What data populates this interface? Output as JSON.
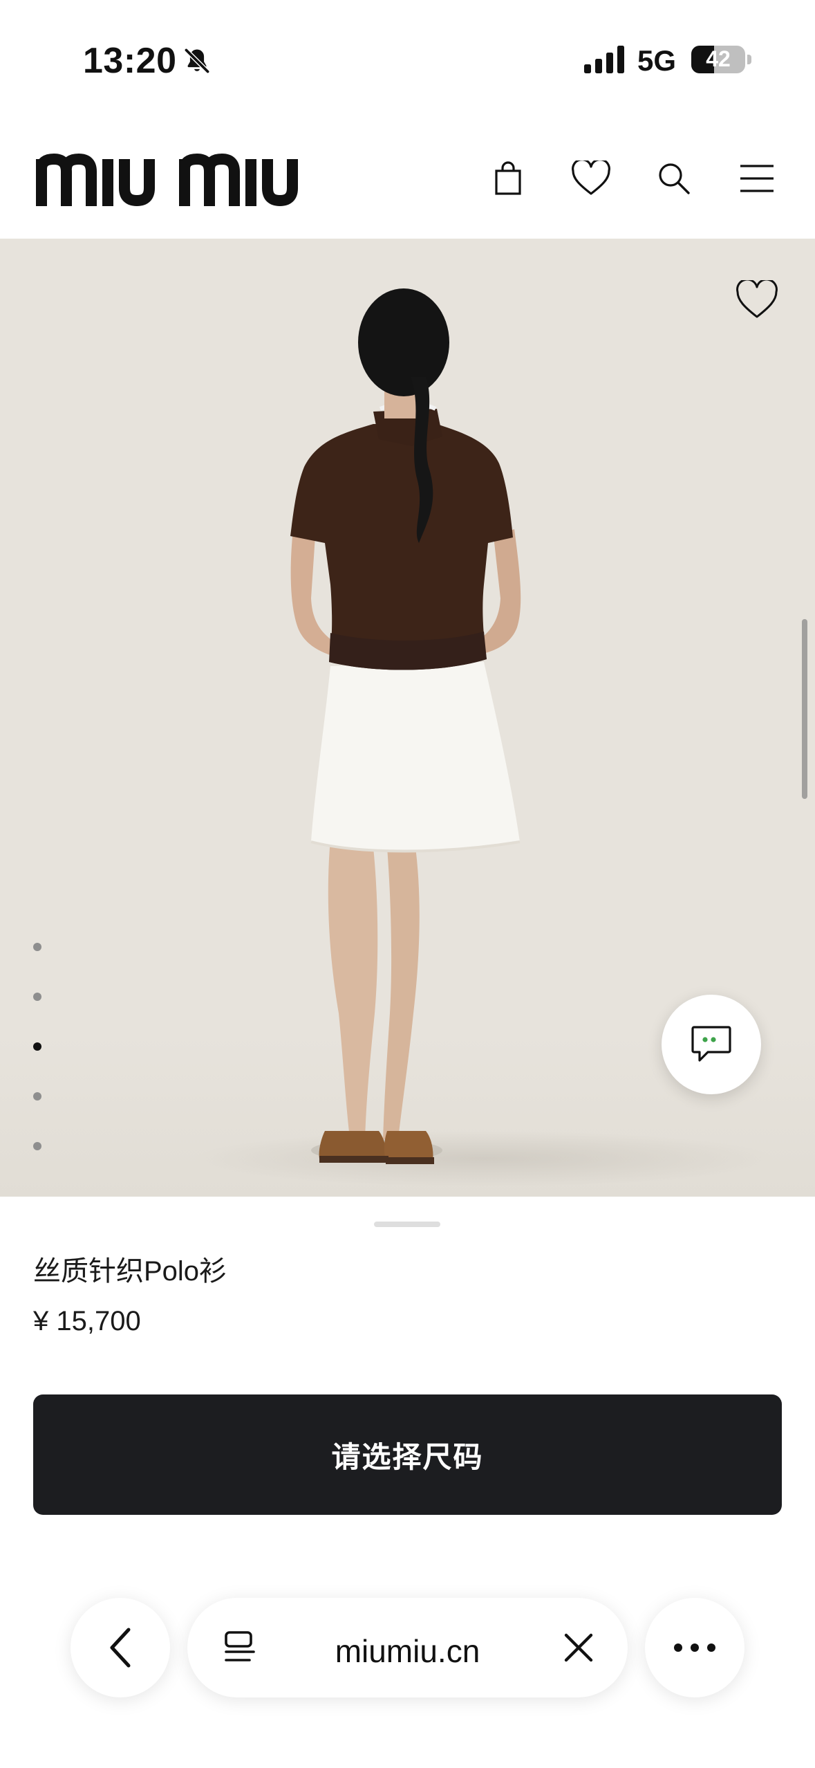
{
  "status_bar": {
    "time": "13:20",
    "network": "5G",
    "battery_level": "42",
    "battery_fraction": 0.42,
    "icons": [
      "bell-slash-icon",
      "signal-icon",
      "battery-icon"
    ]
  },
  "header": {
    "brand": "miu miu",
    "icons": [
      "shopping-bag-icon",
      "heart-icon",
      "search-icon",
      "menu-icon"
    ]
  },
  "gallery": {
    "image_count": 5,
    "active_index": 2,
    "image_alt": "",
    "icons": [
      "heart-icon",
      "chat-icon"
    ]
  },
  "product": {
    "name": "丝质针织Polo衫",
    "price": "¥ 15,700",
    "cta_label": "请选择尺码"
  },
  "browser": {
    "url": "miumiu.cn",
    "icons": [
      "back-chevron-icon",
      "tabs-icon",
      "close-icon",
      "more-icon"
    ]
  },
  "colors": {
    "background": "#ffffff",
    "hero_background": "#e7e3dc",
    "cta_background": "#1c1d20",
    "cta_text": "#ffffff"
  }
}
